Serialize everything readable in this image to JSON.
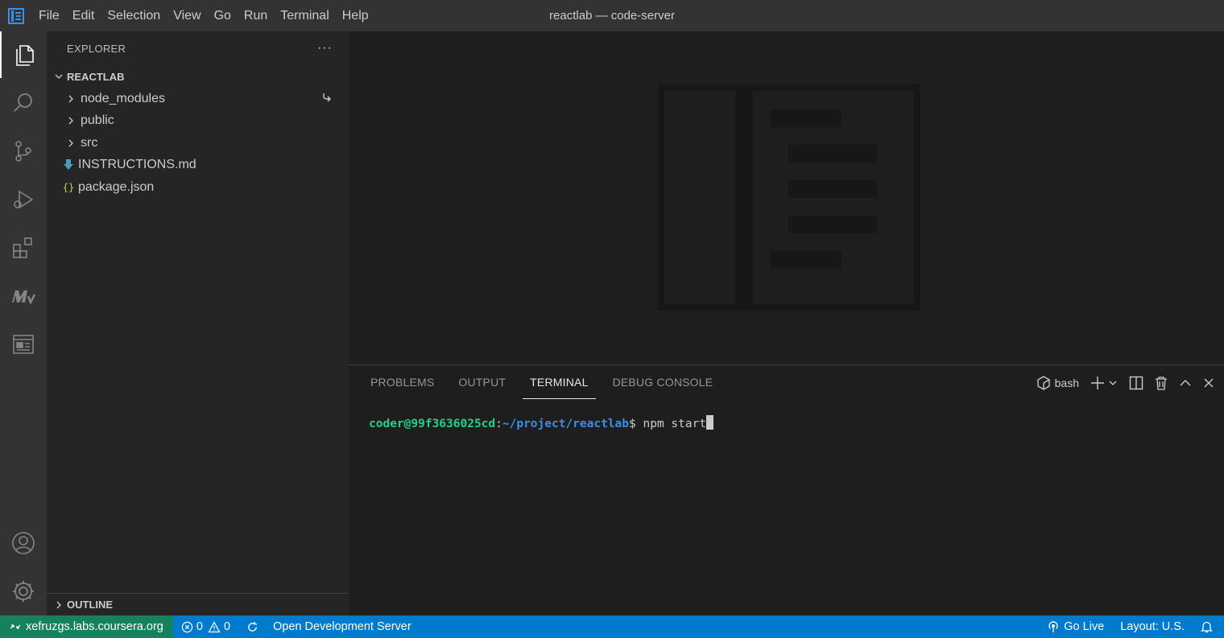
{
  "window": {
    "title": "reactlab — code-server"
  },
  "menu": [
    "File",
    "Edit",
    "Selection",
    "View",
    "Go",
    "Run",
    "Terminal",
    "Help"
  ],
  "sidebar": {
    "title": "EXPLORER",
    "more": "···",
    "root": "REACTLAB",
    "items": [
      {
        "label": "node_modules",
        "type": "folder"
      },
      {
        "label": "public",
        "type": "folder"
      },
      {
        "label": "src",
        "type": "folder"
      },
      {
        "label": "INSTRUCTIONS.md",
        "type": "markdown"
      },
      {
        "label": "package.json",
        "type": "json"
      }
    ],
    "json_icon": "{}",
    "outline": "OUTLINE"
  },
  "panel": {
    "tabs": [
      "PROBLEMS",
      "OUTPUT",
      "TERMINAL",
      "DEBUG CONSOLE"
    ],
    "active_tab": "TERMINAL",
    "shell": "bash"
  },
  "terminal": {
    "user": "coder@99f3636025cd",
    "separator": ":",
    "path": "~/project/reactlab",
    "prompt": "$ ",
    "command": "npm start"
  },
  "status": {
    "remote": "xefruzgs.labs.coursera.org",
    "errors": "0",
    "warnings": "0",
    "open_server": "Open Development Server",
    "go_live": "Go Live",
    "layout": "Layout: U.S."
  },
  "colors": {
    "status_bar": "#007acc",
    "remote": "#16825d",
    "prompt_user": "#23d18b",
    "prompt_path": "#3b8eea"
  }
}
